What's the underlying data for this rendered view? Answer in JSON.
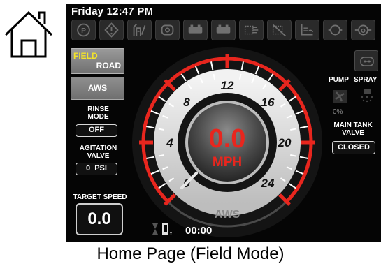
{
  "header": {
    "time_text": "Friday 12:47 PM"
  },
  "status_icons": [
    "park-icon",
    "warning-icon",
    "fuel-icon",
    "engine-icon",
    "battery-icon",
    "battery-icon-2",
    "coolant-icon",
    "transmission-icon",
    "hydraulic-icon",
    "filter-icon",
    "dpf-icon"
  ],
  "mode": {
    "field_label": "FIELD",
    "road_label": "ROAD",
    "aws_label": "AWS"
  },
  "rinse": {
    "title_line1": "RINSE",
    "title_line2": "MODE",
    "value": "OFF"
  },
  "agitation": {
    "title_line1": "AGITATION",
    "title_line2": "VALVE",
    "value": "0",
    "unit": "PSI"
  },
  "target_speed": {
    "title": "TARGET SPEED",
    "value": "0.0"
  },
  "speedometer": {
    "speed": 0.0,
    "speed_text": "0.0",
    "unit": "MPH",
    "min": 0,
    "max": 24,
    "ticks": [
      "0",
      "4",
      "8",
      "12",
      "16",
      "20",
      "24"
    ],
    "bottom_label": "AWS",
    "accent_color": "#e8261e"
  },
  "pump": {
    "label": "PUMP",
    "percent_text": "0%"
  },
  "spray": {
    "label": "SPRAY"
  },
  "main_tank": {
    "title_line1": "MAIN TANK",
    "title_line2": "VALVE",
    "value": "CLOSED"
  },
  "timer": {
    "value": "00:00"
  },
  "caption": "Home Page (Field Mode)"
}
